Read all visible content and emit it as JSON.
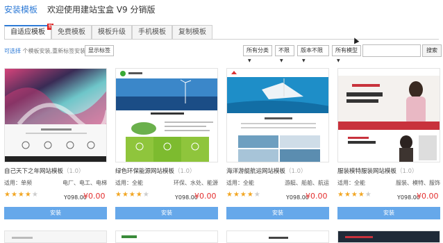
{
  "header": {
    "title": "安装模板",
    "subtitle": "欢迎使用建站宝盒 V9 分销版"
  },
  "tabs": [
    {
      "label": "自适应模板",
      "badge": "新"
    },
    {
      "label": "免费模板"
    },
    {
      "label": "模板升级"
    },
    {
      "label": "手机模板"
    },
    {
      "label": "复制模板"
    }
  ],
  "filter": {
    "hint_prefix": "可选择",
    "hint_text": "个模板安装,重新标签安装",
    "select_button": "显示标签",
    "dropdowns": [
      "所有分类",
      "不限",
      "版本不限",
      "所有模型"
    ],
    "search_button": "搜索"
  },
  "cards": [
    {
      "title": "自己天下之年网站模板",
      "num": "（1.0）",
      "type": "适用：单频",
      "tags": "电厂、电工、电梯",
      "stars": 4,
      "old_price": "Y098.00",
      "new_price": "¥0.00",
      "button": "安装"
    },
    {
      "title": "绿色环保能源网站模板",
      "num": "（1.0）",
      "type": "适用：全能",
      "tags": "环保、水处、能源",
      "stars": 4,
      "old_price": "Y098.00",
      "new_price": "¥0.00",
      "button": "安装"
    },
    {
      "title": "海洋游艇航运网站模板",
      "num": "（1.0）",
      "type": "适用：全能",
      "tags": "游艇、船舶、航运",
      "stars": 4,
      "old_price": "Y098.00",
      "new_price": "¥0.00",
      "button": "安装"
    },
    {
      "title": "服装模特服装网站模板",
      "num": "（1.0）",
      "type": "适用：全能",
      "tags": "服装、模特、服饰",
      "stars": 4,
      "old_price": "Y098.00",
      "new_price": "¥0.00",
      "button": "安装"
    }
  ],
  "colors": {
    "accent": "#2d7ad6",
    "button": "#66a8ea",
    "price": "#e32d2d",
    "star": "#f2a623"
  }
}
